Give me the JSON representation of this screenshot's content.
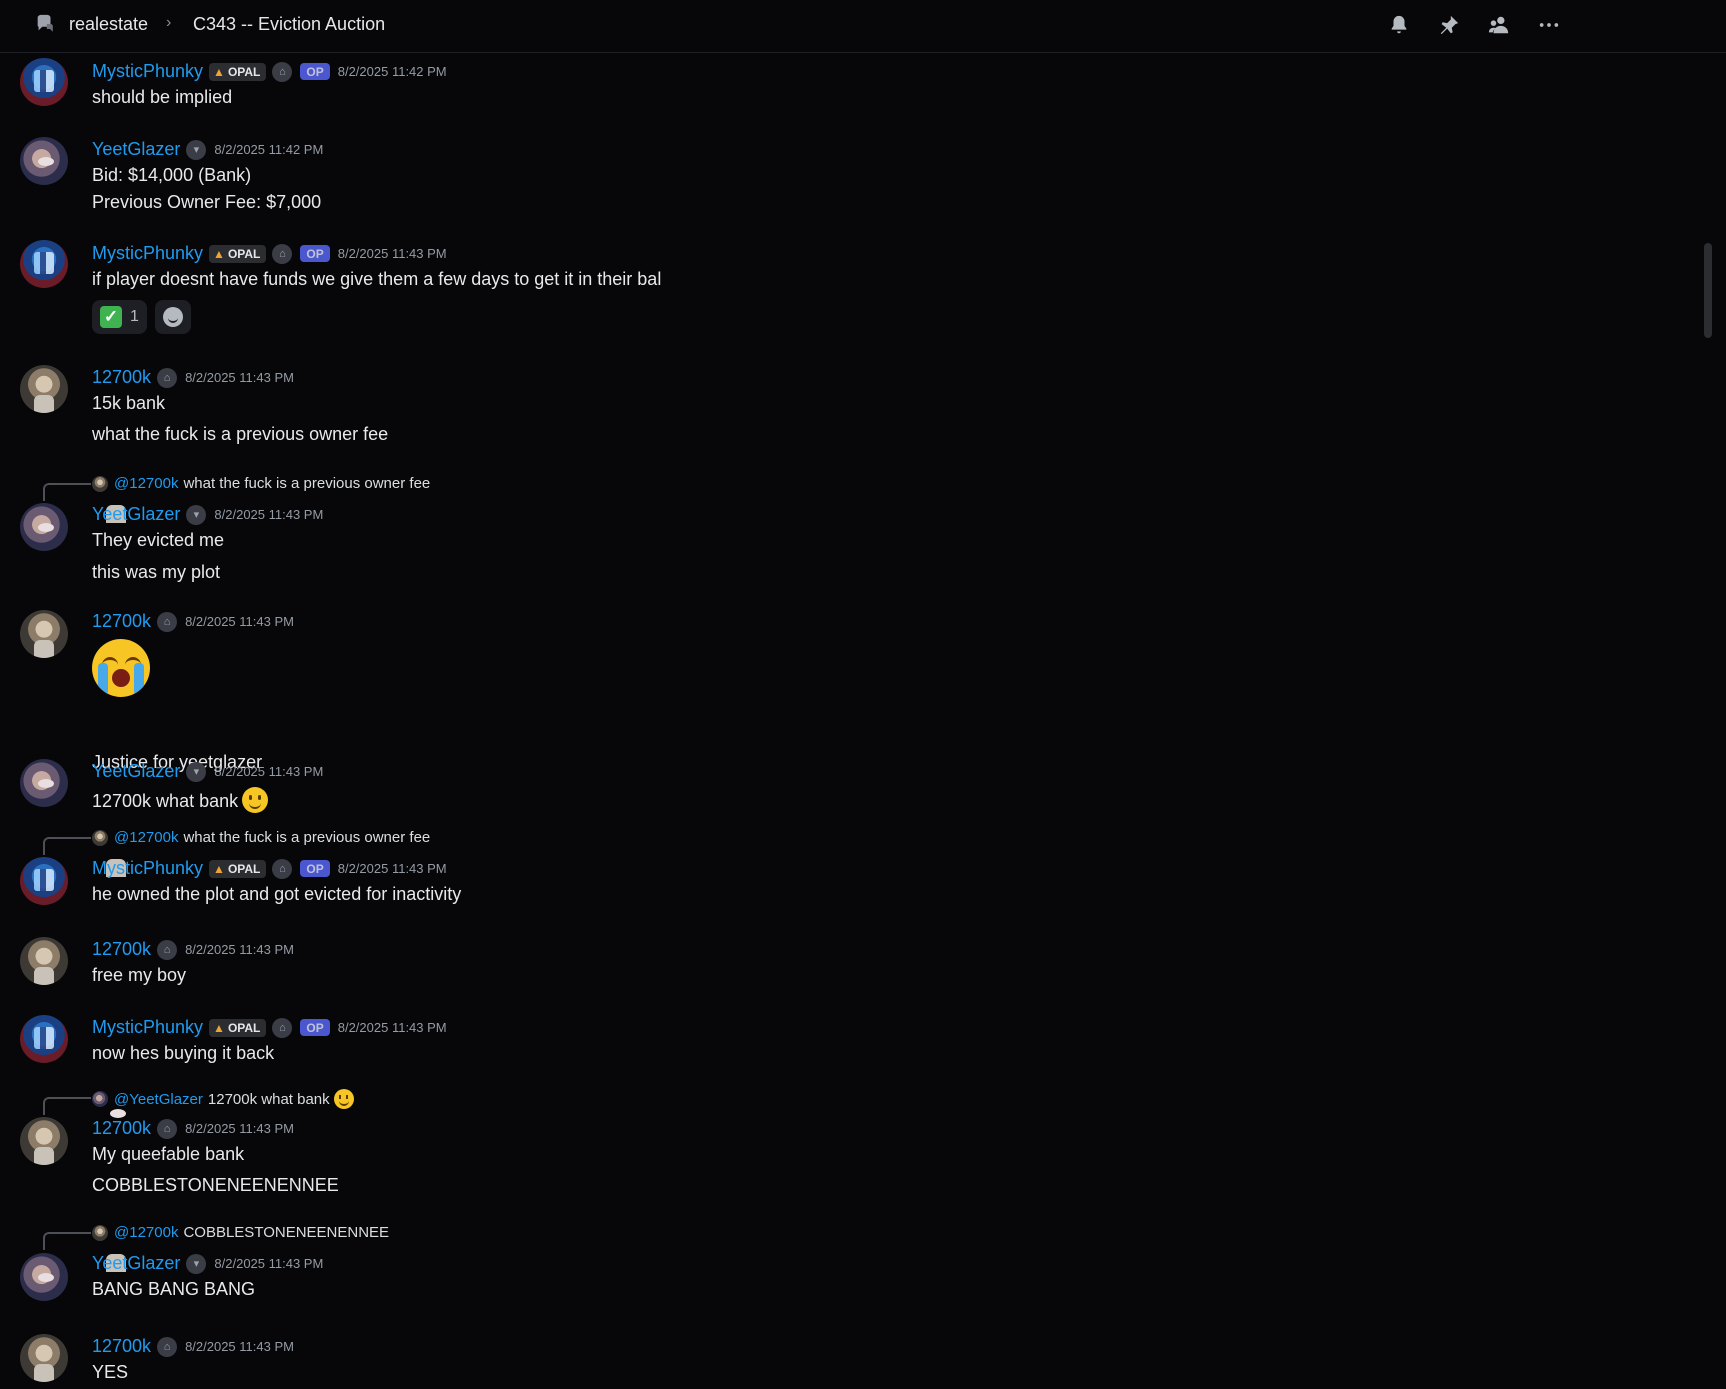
{
  "header": {
    "server": "realestate",
    "separator": "›",
    "thread_title": "C343 -- Eviction Auction",
    "icons": [
      "thread-icon",
      "bell-icon",
      "pin-icon",
      "members-icon",
      "more-icon"
    ]
  },
  "badges": {
    "opal": "OPAL",
    "op": "OP"
  },
  "messages": [
    {
      "author": "MysticPhunky",
      "time": "8/2/2025 11:42 PM",
      "lines": [
        "should be implied"
      ]
    },
    {
      "author": "YeetGlazer",
      "time": "8/2/2025 11:42 PM",
      "lines": [
        "Bid: $14,000 (Bank)",
        "Previous Owner Fee: $7,000"
      ]
    },
    {
      "author": "MysticPhunky",
      "time": "8/2/2025 11:43 PM",
      "lines": [
        "if player doesnt have funds we give them a few days to get it in their bal"
      ],
      "reaction_count": "1"
    },
    {
      "author": "12700k",
      "time": "8/2/2025 11:43 PM",
      "lines": [
        "15k bank",
        "what the fuck is a previous owner fee"
      ]
    },
    {
      "author": "YeetGlazer",
      "time": "8/2/2025 11:43 PM",
      "reply_to": "@12700k",
      "reply_text": "what the fuck is a previous owner fee",
      "lines": [
        "They evicted me",
        "this was my plot"
      ]
    },
    {
      "author": "12700k",
      "time": "8/2/2025 11:43 PM",
      "lines": [
        "Justice for yeetglazer"
      ]
    },
    {
      "author": "YeetGlazer",
      "time": "8/2/2025 11:43 PM",
      "lines": [
        "12700k what bank"
      ]
    },
    {
      "author": "MysticPhunky",
      "time": "8/2/2025 11:43 PM",
      "reply_to": "@12700k",
      "reply_text": "what the fuck is a previous owner fee",
      "lines": [
        "he owned the plot and got evicted for inactivity"
      ]
    },
    {
      "author": "12700k",
      "time": "8/2/2025 11:43 PM",
      "lines": [
        "free my boy"
      ]
    },
    {
      "author": "MysticPhunky",
      "time": "8/2/2025 11:43 PM",
      "lines": [
        "now hes buying it back"
      ]
    },
    {
      "author": "12700k",
      "time": "8/2/2025 11:43 PM",
      "reply_to": "@YeetGlazer",
      "reply_text": "12700k what bank",
      "lines": [
        "My queefable bank",
        "COBBLESTONENEENENNEE"
      ]
    },
    {
      "author": "YeetGlazer",
      "time": "8/2/2025 11:43 PM",
      "reply_to": "@12700k",
      "reply_text": "COBBLESTONENEENENNEE",
      "lines": [
        "BANG BANG BANG"
      ]
    },
    {
      "author": "12700k",
      "time": "8/2/2025 11:43 PM",
      "lines": [
        "YES"
      ]
    }
  ],
  "colors": {
    "background": "#070709",
    "username": "#1f9bf0",
    "timestamp": "#949ba4",
    "op_badge": "#5865f2"
  }
}
